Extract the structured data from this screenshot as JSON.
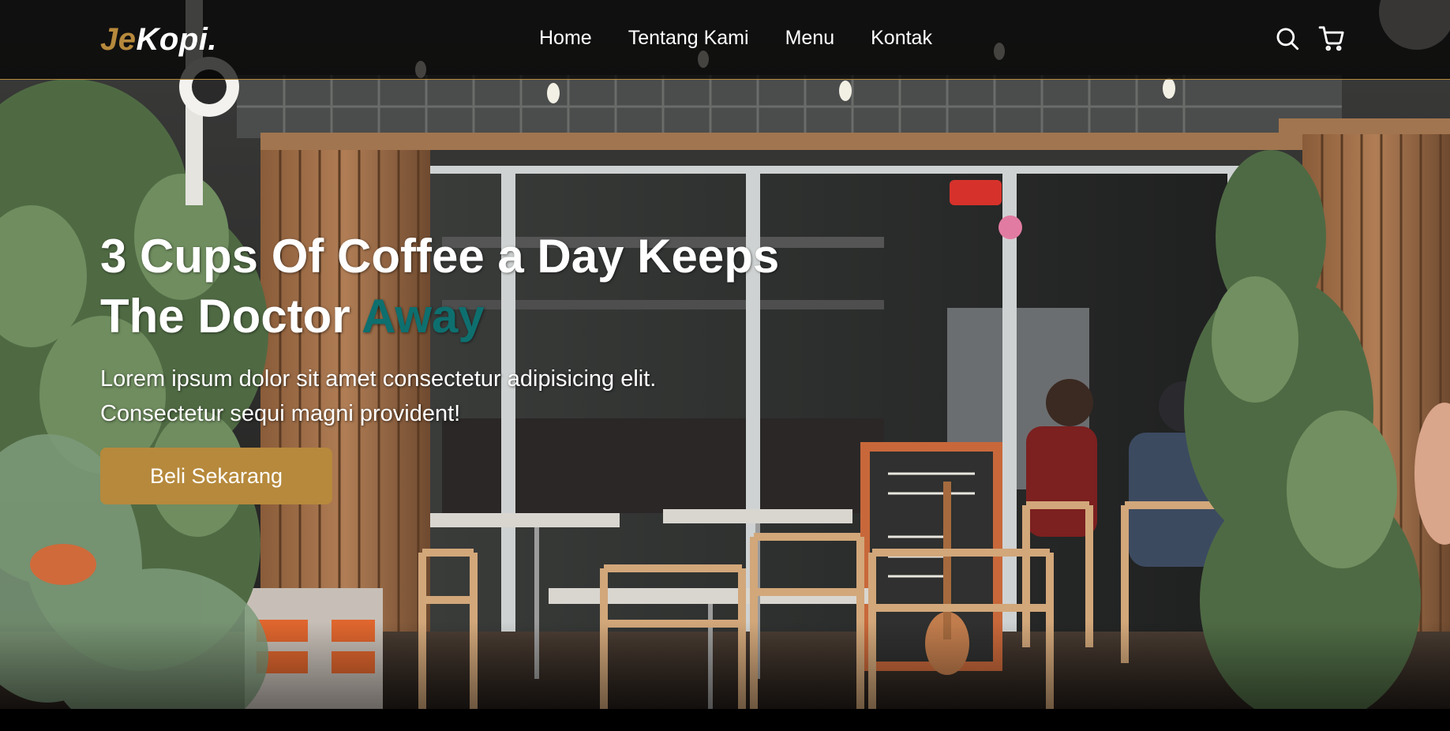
{
  "brand": {
    "accent": "Je",
    "rest": "Kopi."
  },
  "nav": {
    "links": [
      "Home",
      "Tentang Kami",
      "Menu",
      "Kontak"
    ],
    "icons": [
      "search-icon",
      "shopping-cart-icon"
    ]
  },
  "hero": {
    "headline_line1": "3 Cups Of Coffee a Day Keeps",
    "headline_line2_main": "The Doctor",
    "headline_line2_accent": "Away",
    "subtext": "Lorem ipsum dolor sit amet consectetur adipisicing elit. Consectetur sequi magni provident!",
    "cta_label": "Beli Sekarang"
  },
  "colors": {
    "primary": "#b6893c",
    "accent_text": "#0e6f6f",
    "navbar_bg": "rgba(0,0,0,0.72)",
    "text": "#ffffff"
  }
}
